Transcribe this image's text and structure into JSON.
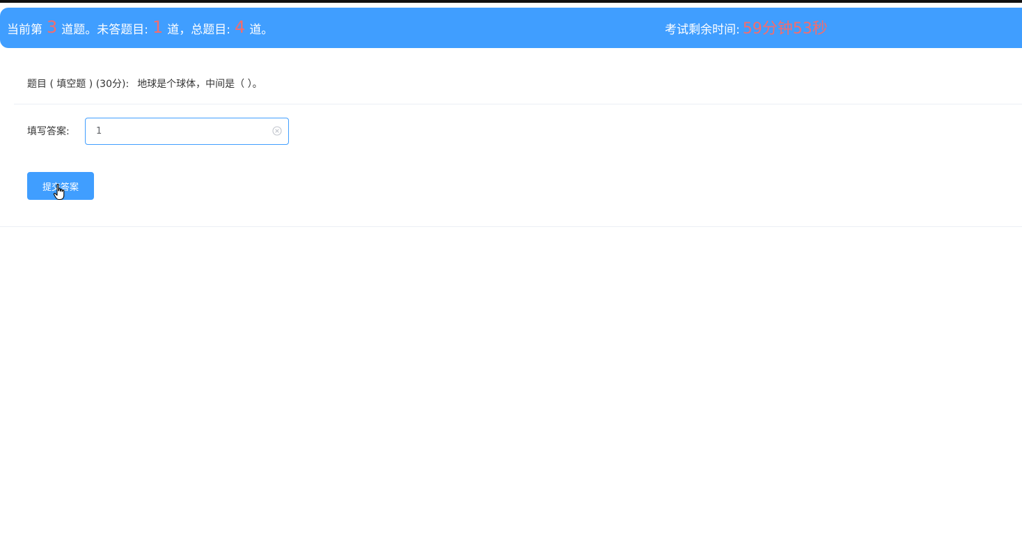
{
  "header": {
    "current_prefix": "当前第",
    "current_number": "3",
    "current_suffix": "道题。未答题目:",
    "unanswered_number": "1",
    "unanswered_suffix": "道，总题目:",
    "total_number": "4",
    "total_suffix": "道。",
    "timer_label": "考试剩余时间:",
    "timer_value": "59分钟53秒"
  },
  "question": {
    "prefix": "题目 ( 填空题 ) (30分):",
    "text": "地球是个球体，中间是（ ）。"
  },
  "answer": {
    "label": "填写答案:",
    "value": "1"
  },
  "submit": {
    "label": "提交答案"
  },
  "icons": {
    "clear": "circle-close-icon",
    "cursor": "hand-pointer-icon"
  },
  "colors": {
    "primary": "#409eff",
    "highlight": "#f56c6c"
  }
}
